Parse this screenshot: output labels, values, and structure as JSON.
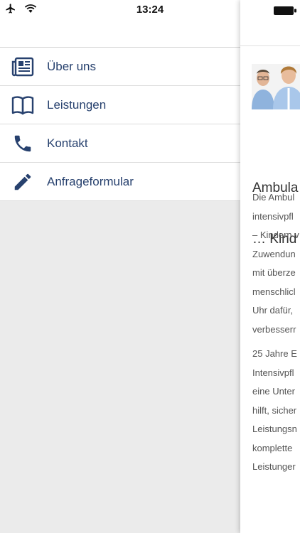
{
  "status_bar": {
    "time": "13:24"
  },
  "menu": {
    "items": [
      {
        "label": "Über uns",
        "icon": "newspaper-icon"
      },
      {
        "label": "Leistungen",
        "icon": "book-icon"
      },
      {
        "label": "Kontakt",
        "icon": "phone-icon"
      },
      {
        "label": "Anfrageformular",
        "icon": "pencil-icon"
      }
    ]
  },
  "content": {
    "title_lines": [
      "Ambula",
      "… Kind"
    ],
    "paragraph1_lines": [
      "Die Ambul",
      "intensivpfl",
      "– Kindern v",
      "Zuwendun",
      "mit überze",
      "menschlicl",
      "Uhr dafür,",
      "verbesserr"
    ],
    "paragraph2_lines": [
      "25 Jahre E",
      "Intensivpfl",
      "eine Unter",
      "hilft, sicher",
      "Leistungsn",
      "komplette",
      "Leistunger"
    ]
  },
  "colors": {
    "accent": "#27416e",
    "drawer_bg": "#ebebeb",
    "content_text": "#555555"
  }
}
